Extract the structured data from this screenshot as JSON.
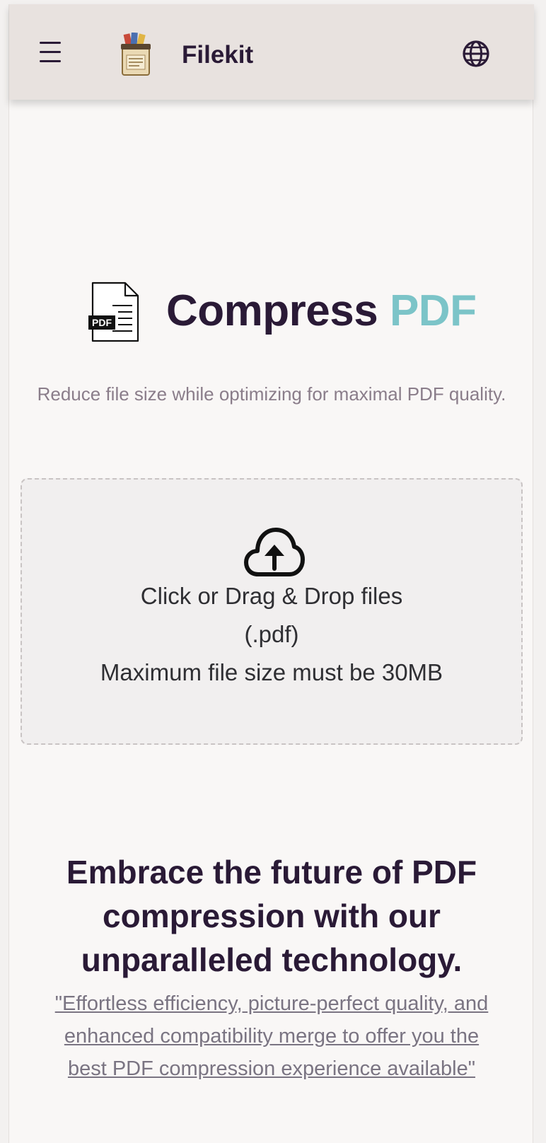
{
  "navbar": {
    "brand": "Filekit",
    "menu_icon": "hamburger-menu-icon",
    "logo_icon": "file-box-logo-icon",
    "language_icon": "globe-icon"
  },
  "hero": {
    "icon": "pdf-file-icon",
    "icon_label": "PDF",
    "title_main": "Compress",
    "title_accent": "PDF",
    "subtitle": "Reduce file size while optimizing for maximal PDF quality."
  },
  "dropzone": {
    "icon": "cloud-upload-icon",
    "line1": "Click or Drag & Drop files",
    "line2": "(.pdf)",
    "line3": "Maximum file size must be 30MB"
  },
  "promo": {
    "heading": "Embrace the future of PDF compression with our unparalleled technology.",
    "quote": "\"Effortless efficiency, picture-perfect quality, and enhanced compatibility merge to offer you the best PDF compression experience available\""
  },
  "colors": {
    "navbar_bg": "#e8e2df",
    "text_dark": "#2a1a36",
    "accent": "#7cc4c8",
    "muted_text": "#8a7d8a",
    "page_bg": "#f9f7f6"
  }
}
